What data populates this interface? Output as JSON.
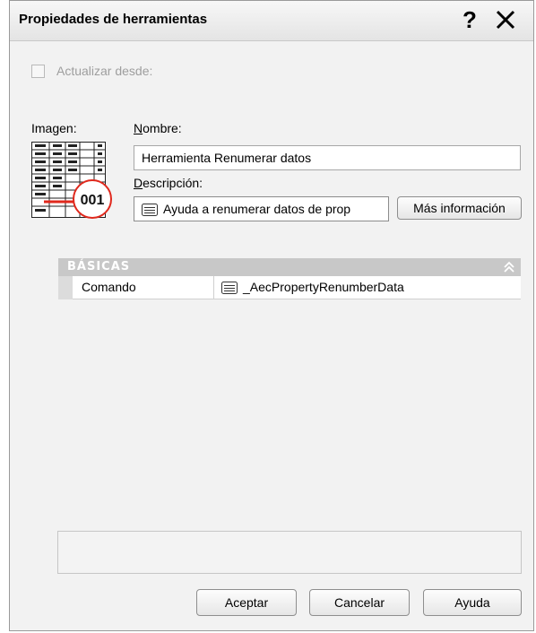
{
  "dialog": {
    "title": "Propiedades de herramientas",
    "help_label": "?",
    "update_from_label": "Actualizar desde:"
  },
  "image": {
    "label": "Imagen:",
    "thumbnail_badge": "001",
    "icon": "renumber-data-icon"
  },
  "name": {
    "label": "Nombre:",
    "value": "Herramienta Renumerar datos"
  },
  "description": {
    "label": "Descripción:",
    "value": "Ayuda a renumerar datos de prop",
    "more_info_button": "Más información"
  },
  "section": {
    "title": "BÁSICAS",
    "properties": [
      {
        "name": "Comando",
        "value": "_AecPropertyRenumberData"
      }
    ]
  },
  "buttons": {
    "ok": "Aceptar",
    "cancel": "Cancelar",
    "help": "Ayuda"
  },
  "colors": {
    "accent_red": "#e0281c",
    "panel_header": "#c8c8c8",
    "disabled_text": "#9e9e9e"
  }
}
